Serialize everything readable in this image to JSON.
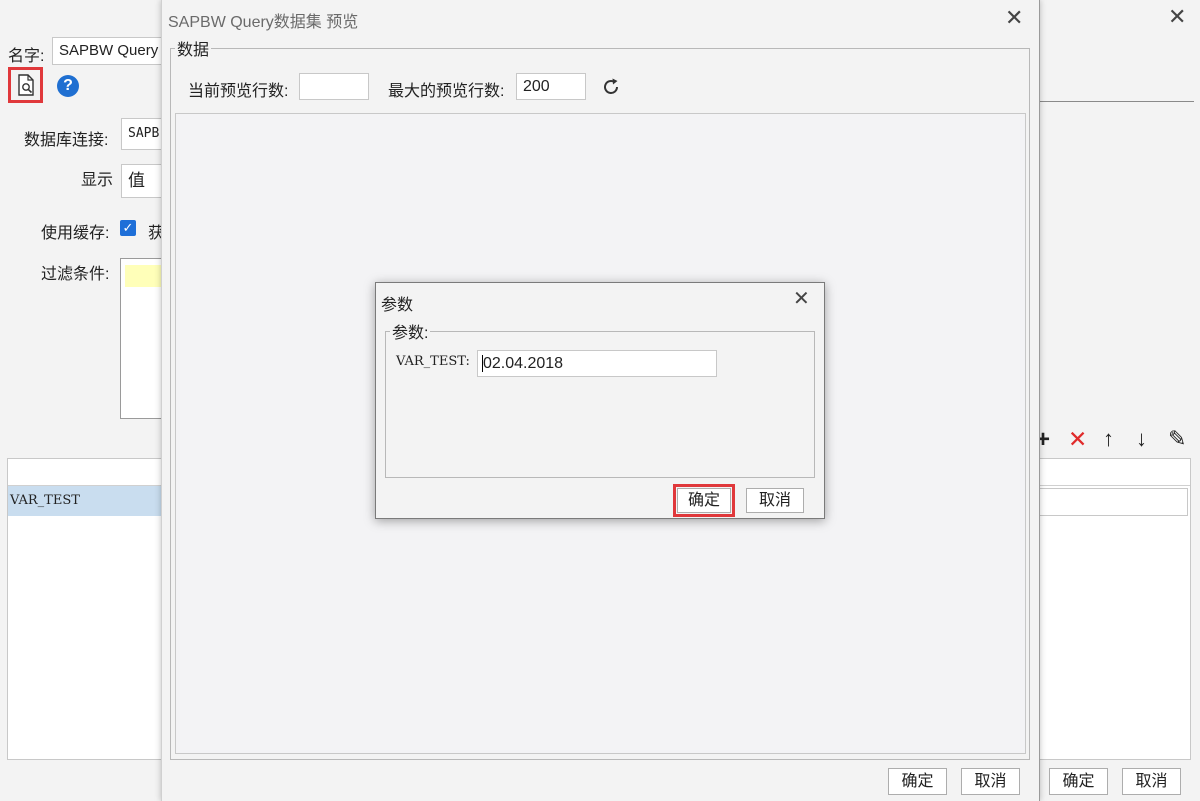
{
  "background_window": {
    "title_partial": "",
    "name_label": "名字:",
    "name_value": "SAPBW Query",
    "db_connection_label": "数据库连接:",
    "db_connection_value": "SAPB",
    "display_label": "显示",
    "display_value": "值",
    "use_cache_label": "使用缓存:",
    "use_cache_checked": true,
    "use_cache_trailing_text": "获",
    "filter_label": "过滤条件:",
    "param_row_name": "VAR_TEST",
    "ok_label": "确定",
    "cancel_label": "取消",
    "toolbar_icons": [
      "add-icon",
      "delete-icon",
      "move-up-icon",
      "move-down-icon",
      "edit-icon"
    ]
  },
  "preview_window": {
    "title": "SAPBW Query数据集 预览",
    "group_legend": "数据",
    "current_rows_label": "当前预览行数:",
    "current_rows_value": "",
    "max_rows_label": "最大的预览行数:",
    "max_rows_value": "200",
    "ok_label": "确定",
    "cancel_label": "取消"
  },
  "param_dialog": {
    "title": "参数",
    "group_legend": "参数:",
    "var_label": "VAR_TEST:",
    "var_value": "02.04.2018",
    "ok_label": "确定",
    "cancel_label": "取消"
  },
  "colors": {
    "highlight": "#e0383b",
    "selection_row": "#c9ddef",
    "help_blue": "#1f6fd1",
    "delete_red": "#e02b2b",
    "checkbox_blue": "#1e6fd8",
    "filter_yellow": "#ffffb9"
  }
}
